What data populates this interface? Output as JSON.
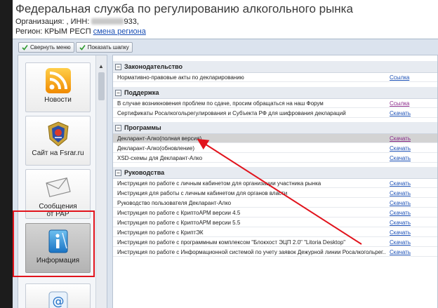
{
  "header": {
    "title": "Федеральная служба по регулированию алкогольного рынка",
    "org_label": "Организация: , ИНН: ",
    "inn_tail": "933,",
    "region_label": "Регион: КРЫМ РЕСП",
    "region_link": "смена региона"
  },
  "toolbar": {
    "collapse_menu": "Свернуть меню",
    "show_header": "Показать шапку"
  },
  "sidebar": {
    "items": [
      {
        "label": "Новости",
        "icon": "rss-icon"
      },
      {
        "label": "Сайт на Fsrar.ru",
        "icon": "emblem-icon"
      },
      {
        "label": "Сообщения",
        "label2": "от РАР",
        "icon": "envelope-icon"
      },
      {
        "label": "Информация",
        "icon": "info-icon"
      },
      {
        "label": "",
        "icon": "at-icon"
      }
    ]
  },
  "sections": [
    {
      "title": "Законодательство",
      "rows": [
        {
          "text": "Нормативно-правовые акты по декларированию",
          "link": "Ссылка"
        }
      ]
    },
    {
      "title": "Поддержка",
      "rows": [
        {
          "text": "В случае возникновения проблем по сдаче, просим обращаться на наш Форум",
          "link": "Ссылка"
        },
        {
          "text": "Сертификаты Росалкогольрегулирования и Субъекта РФ для шифрования деклараций",
          "link": "Скачать"
        }
      ]
    },
    {
      "title": "Программы",
      "rows": [
        {
          "text": "Декларант-Алко(полная версия)",
          "link": "Скачать"
        },
        {
          "text": "Декларант-Алко(обновление)",
          "link": "Скачать"
        },
        {
          "text": "XSD-схемы для Декларант-Алко",
          "link": "Скачать"
        }
      ]
    },
    {
      "title": "Руководства",
      "rows": [
        {
          "text": "Инструкция по работе с личным кабинетом для организации участника рынка",
          "link": "Скачать"
        },
        {
          "text": "Инструкция для работы с личным кабинетом для органов власти",
          "link": "Скачать"
        },
        {
          "text": "Руководство пользователя Декларант-Алко",
          "link": "Скачать"
        },
        {
          "text": "Инструкция по работе с КриптоАРМ версии 4.5",
          "link": "Скачать"
        },
        {
          "text": "Инструкция по работе с КриптоАРМ версии 5.5",
          "link": "Скачать"
        },
        {
          "text": "Инструкция по работе с КриптЭК",
          "link": "Скачать"
        },
        {
          "text": "Инструкция по работе с программным комплексом \"Блокхост ЭЦП 2.0\" \"Litoria Desktop\"",
          "link": "Скачать"
        },
        {
          "text": "Инструкция по работе с Информационной системой по учету заявок Дежурной линии Росалкогольрег...",
          "link": "Скачать"
        }
      ]
    }
  ],
  "colors": {
    "accent": "#1a4fb5",
    "annotation": "#e1131c"
  }
}
